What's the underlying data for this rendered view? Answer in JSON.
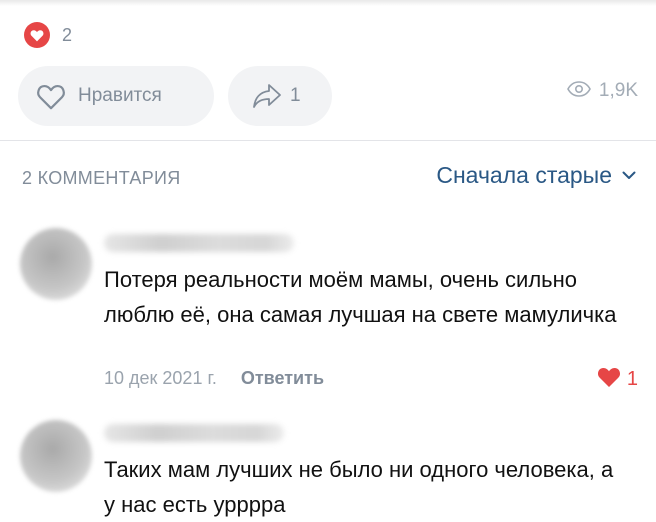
{
  "post": {
    "reactions": {
      "icon": "heart-icon",
      "count": "2",
      "color": "#e64646"
    },
    "like_button": {
      "icon": "heart-outline-icon",
      "label": "Нравится"
    },
    "share_button": {
      "icon": "share-arrow-icon",
      "count": "1"
    },
    "views": {
      "icon": "eye-icon",
      "count": "1,9K"
    }
  },
  "comments_section": {
    "title": "2 КОММЕНТАРИЯ",
    "sort_label": "Сначала старые",
    "sort_icon": "chevron-down-icon",
    "accent_color": "#2a5885",
    "items": [
      {
        "text": "Потеря реальности моём мамы, очень сильно люблю её, она самая лучшая на свете мамуличка",
        "date": "10 дек 2021 г.",
        "reply_label": "Ответить",
        "likes": "1"
      },
      {
        "text": "Таких мам лучших не было ни одного человека, а у нас есть урррра"
      }
    ]
  }
}
